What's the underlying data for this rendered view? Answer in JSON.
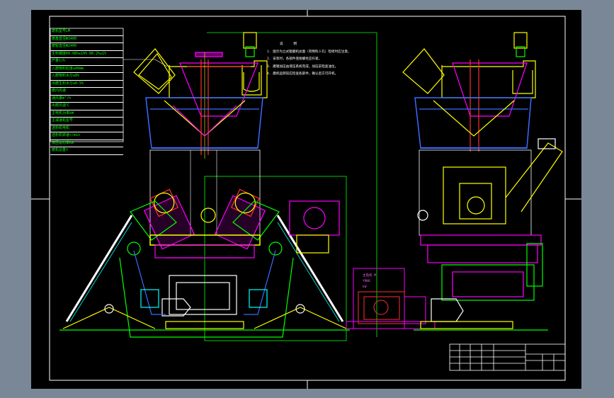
{
  "spec_table": {
    "rows": [
      "磨机型号LM",
      "磨盘直径Φ3400",
      "磨辊直径Φ2400",
      "生料细度R0.08%≤10%  R0.2%≤1%",
      "产量t/h",
      "入磨物料粒度≤40mm",
      "入磨物料水分≤8%",
      "出磨生料水分≤0.5%",
      "磨内风速",
      "通风量m³/h",
      "出磨风温℃",
      "主电机功率kW",
      "主减速机型号",
      "选粉机电机",
      "选粉机转速r/min",
      "液压站功率kW",
      "磨机总重t"
    ]
  },
  "notes": {
    "title": "说 明",
    "items": [
      "1. 图示为立式辊磨机总图（有物料人孔）检修时应注意。",
      "2. 安装时，各部件连接螺栓应拧紧。",
      "3. 磨辊加压由液压系统完成，加压前检查油位。",
      "4. 磨机运转前应检查各部件，确认后方可开机。"
    ]
  },
  "motor_label": {
    "lines": [
      "主电机 M",
      "YRKK",
      "kW"
    ]
  },
  "colors": {
    "background": "#7a8796",
    "sheet": "#000000",
    "frame": "#ffffff",
    "green": "#00ff00",
    "yellow": "#ffff00",
    "magenta": "#ff00ff",
    "cyan": "#00ffff",
    "blue": "#3a6bff",
    "red": "#ff3030"
  }
}
